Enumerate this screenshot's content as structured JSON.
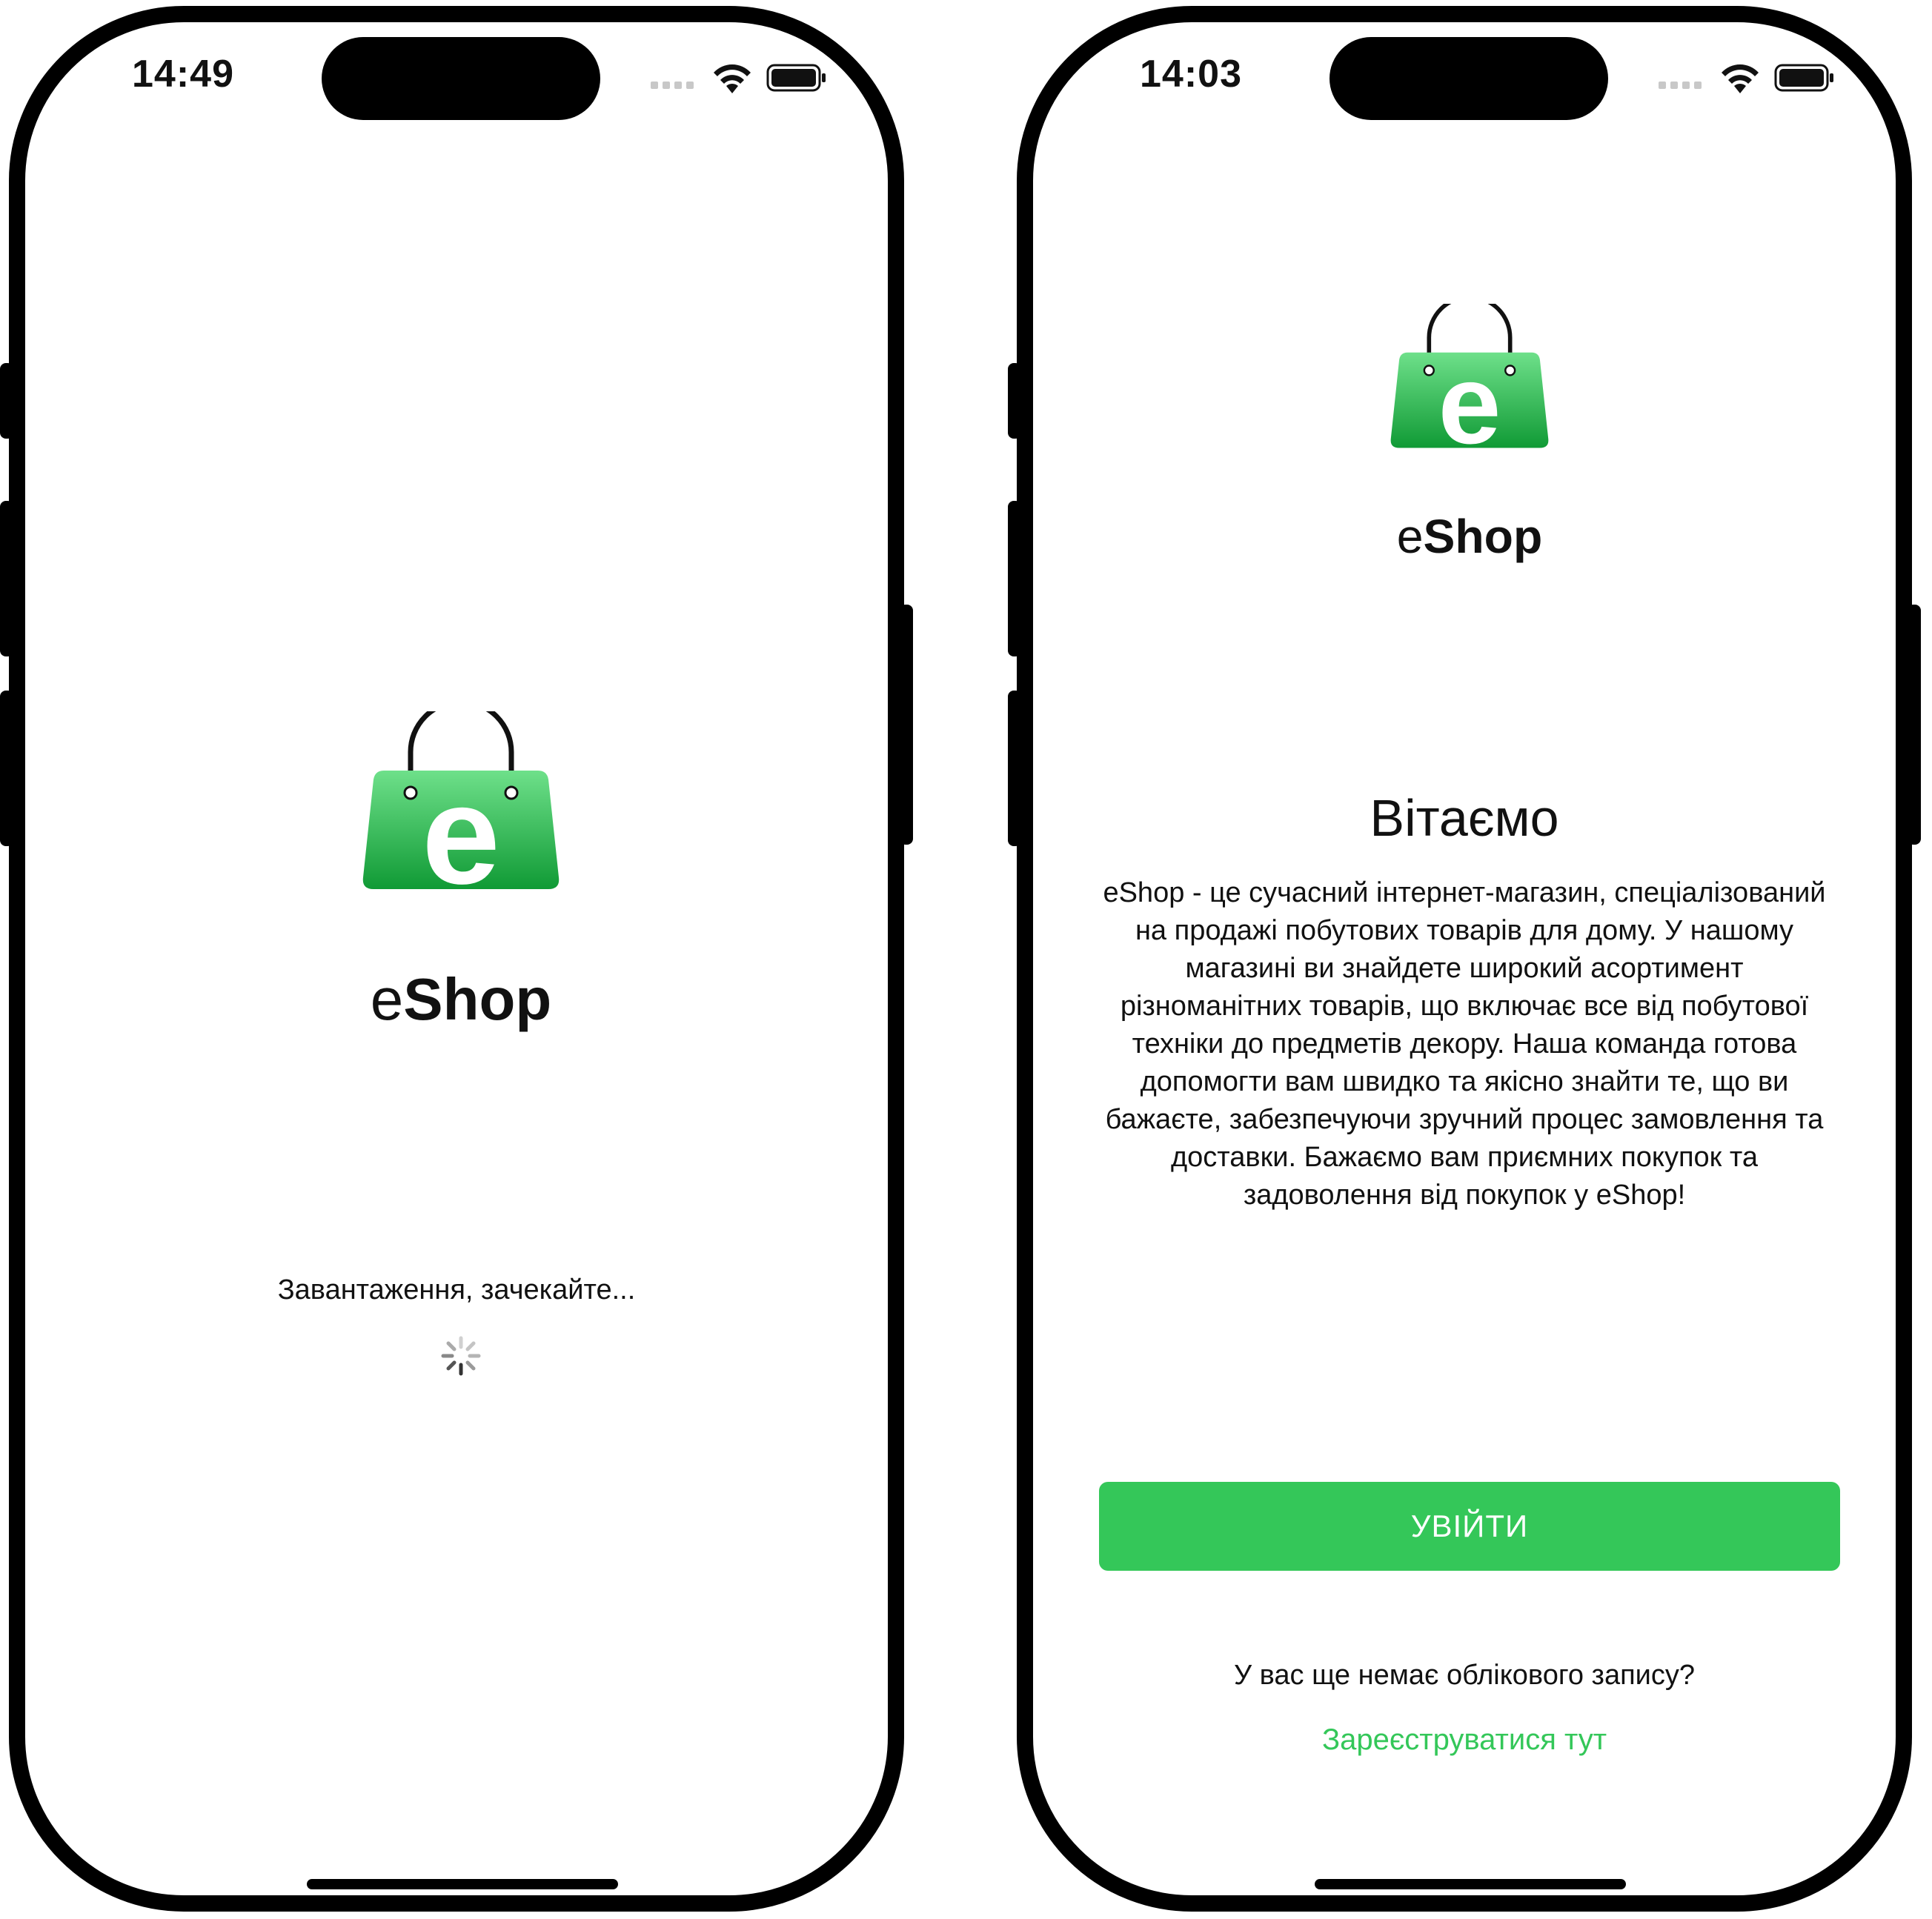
{
  "brand": {
    "name": "eShop",
    "accent_color": "#34c759",
    "logo_icon": "shopping-bag-e-icon"
  },
  "screens": [
    {
      "status_bar": {
        "time": "14:49",
        "icons": [
          "signal-dots-icon",
          "wifi-icon",
          "battery-icon"
        ]
      },
      "loading_text": "Завантаження, зачекайте...",
      "spinner_icon": "activity-spinner-icon"
    },
    {
      "status_bar": {
        "time": "14:03",
        "icons": [
          "signal-dots-icon",
          "wifi-icon",
          "battery-icon"
        ]
      },
      "welcome_title": "Вітаємо",
      "welcome_body": "eShop - це сучасний інтернет-магазин, спеціалізований на продажі побутових товарів для дому. У нашому магазині ви знайдете широкий асортимент різноманітних товарів, що включає все від побутової техніки до предметів декору. Наша команда готова допомогти вам швидко та якісно знайти те, що ви бажаєте, забезпечуючи зручний процес замовлення та доставки. Бажаємо вам приємних покупок та задоволення від покупок у eShop!",
      "login_button": "УВІЙТИ",
      "no_account_text": "У вас ще немає облікового запису?",
      "register_link": "Зареєструватися тут"
    }
  ]
}
